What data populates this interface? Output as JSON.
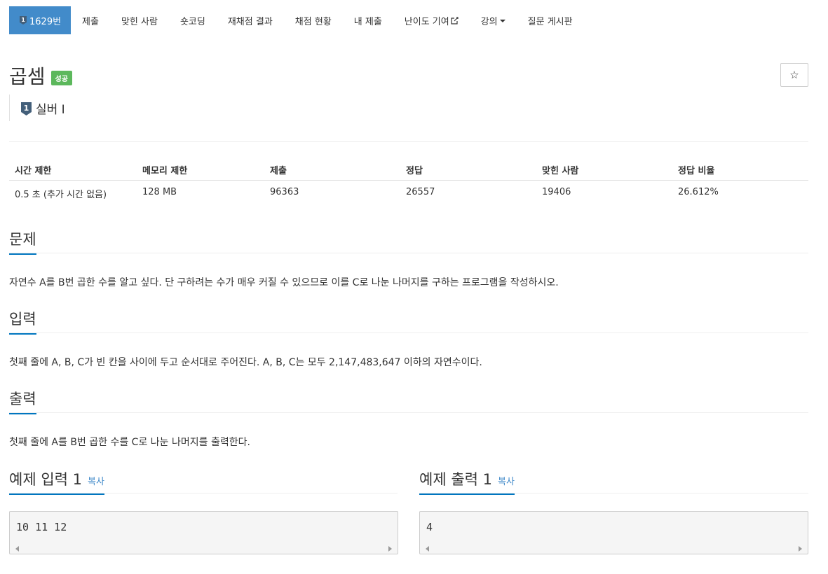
{
  "nav": {
    "problem_tab": "1629번",
    "items": [
      "제출",
      "맞힌 사람",
      "숏코딩",
      "재채점 결과",
      "채점 현황",
      "내 제출",
      "난이도 기여",
      "강의",
      "질문 게시판"
    ]
  },
  "problem": {
    "title": "곱셈",
    "status_badge": "성공",
    "star": "☆",
    "tier": "실버 I",
    "tier_level": "1",
    "colors": {
      "tier_silver": "#435f7a",
      "accent": "#0076c0",
      "success": "#5cb85c",
      "nav_active": "#428bca"
    }
  },
  "stats": {
    "headers": [
      "시간 제한",
      "메모리 제한",
      "제출",
      "정답",
      "맞힌 사람",
      "정답 비율"
    ],
    "values": [
      "0.5 초 (추가 시간 없음)",
      "128 MB",
      "96363",
      "26557",
      "19406",
      "26.612%"
    ]
  },
  "sections": {
    "problem_title": "문제",
    "problem_text": "자연수 A를 B번 곱한 수를 알고 싶다. 단 구하려는 수가 매우 커질 수 있으므로 이를 C로 나눈 나머지를 구하는 프로그램을 작성하시오.",
    "input_title": "입력",
    "input_text": "첫째 줄에 A, B, C가 빈 칸을 사이에 두고 순서대로 주어진다. A, B, C는 모두 2,147,483,647 이하의 자연수이다.",
    "output_title": "출력",
    "output_text": "첫째 줄에 A를 B번 곱한 수를 C로 나눈 나머지를 출력한다."
  },
  "samples": {
    "input_title": "예제 입력 1",
    "output_title": "예제 출력 1",
    "copy_label": "복사",
    "input_value": "10 11 12",
    "output_value": "4"
  }
}
